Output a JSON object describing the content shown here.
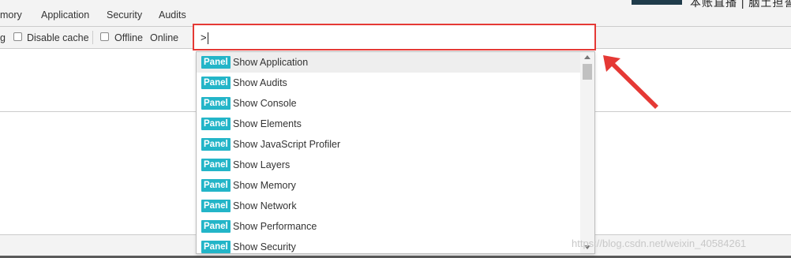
{
  "tabs": [
    {
      "label": "mory"
    },
    {
      "label": "Application"
    },
    {
      "label": "Security"
    },
    {
      "label": "Audits"
    }
  ],
  "toolbar": {
    "cut_label": "g",
    "disable_cache_label": "Disable cache",
    "offline_label": "Offline",
    "online_label": "Online"
  },
  "top_right": {
    "cut_text": "本账直播 | 胭土担誓"
  },
  "command_menu": {
    "input_value": ">",
    "items": [
      {
        "badge": "Panel",
        "label": "Show Application"
      },
      {
        "badge": "Panel",
        "label": "Show Audits"
      },
      {
        "badge": "Panel",
        "label": "Show Console"
      },
      {
        "badge": "Panel",
        "label": "Show Elements"
      },
      {
        "badge": "Panel",
        "label": "Show JavaScript Profiler"
      },
      {
        "badge": "Panel",
        "label": "Show Layers"
      },
      {
        "badge": "Panel",
        "label": "Show Memory"
      },
      {
        "badge": "Panel",
        "label": "Show Network"
      },
      {
        "badge": "Panel",
        "label": "Show Performance"
      },
      {
        "badge": "Panel",
        "label": "Show Security"
      }
    ]
  },
  "watermark": "https://blog.csdn.net/weixin_40584261",
  "colors": {
    "highlight_border": "#e53935",
    "badge_bg": "#23b5c8",
    "arrow": "#e53935"
  }
}
